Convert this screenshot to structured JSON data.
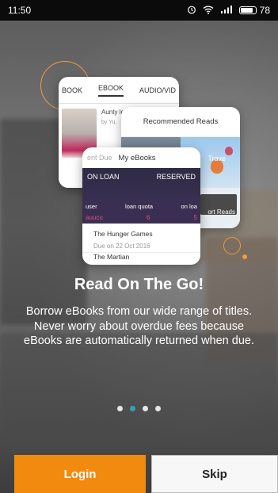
{
  "status_bar": {
    "time": "11:50",
    "battery_text": "78",
    "icons": [
      "alarm-icon",
      "wifi-icon",
      "signal-icon",
      "battery-icon"
    ]
  },
  "card_ebooks": {
    "tabs": [
      "BOOK",
      "EBOOK",
      "AUDIO/VID"
    ],
    "active_tab": "EBOOK",
    "title_text": "Aunty le [electr Singap",
    "author_text": "by Yu,"
  },
  "card_recommended": {
    "title": "Recommended Reads",
    "tile_label": "Trave",
    "bottom_label": "ort Reads"
  },
  "card_myebooks": {
    "tab_left": "ent Due",
    "tab_active": "My eBooks",
    "on_loan_label": "ON LOAN",
    "reserved_label": "RESERVED",
    "stat_labels": [
      "user",
      "loan quota",
      "on loa"
    ],
    "stat_values": [
      "auucu",
      "6",
      "5"
    ],
    "items": [
      {
        "title": "The Hunger Games",
        "due": "Due on 22 Oct 2016"
      },
      {
        "title": "The Martian"
      }
    ]
  },
  "onboarding": {
    "heading": "Read On The Go!",
    "description": "Borrow eBooks from our wide range of titles. Never worry about overdue fees because eBooks are automatically returned when due."
  },
  "pager": {
    "count": 4,
    "active_index": 1
  },
  "buttons": {
    "login": "Login",
    "skip": "Skip"
  },
  "colors": {
    "accent": "#f38a10",
    "pager_active": "#33a3b7",
    "ring": "#f39c3a"
  }
}
